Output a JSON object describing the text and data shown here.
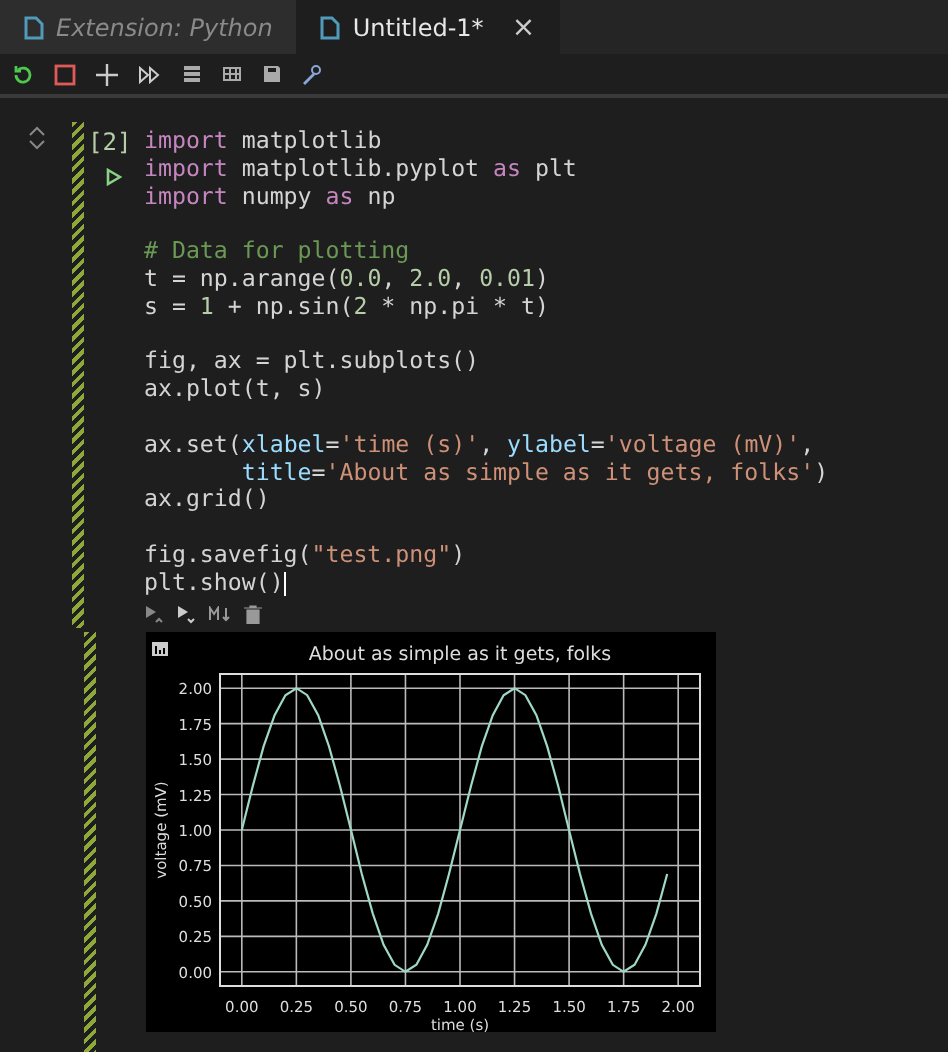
{
  "tabs": [
    {
      "label": "Extension: Python",
      "selected": false
    },
    {
      "label": "Untitled-1*",
      "selected": true,
      "close": "×"
    }
  ],
  "cell": {
    "execution_count": "[2]",
    "code_blocks": [
      [
        [
          {
            "text": "import",
            "kind": "keyword"
          },
          {
            "text": " matplotlib",
            "kind": "plain"
          }
        ],
        [
          {
            "text": "import",
            "kind": "keyword"
          },
          {
            "text": " matplotlib.pyplot ",
            "kind": "plain"
          },
          {
            "text": "as",
            "kind": "keyword"
          },
          {
            "text": " plt",
            "kind": "plain"
          }
        ],
        [
          {
            "text": "import",
            "kind": "keyword"
          },
          {
            "text": " numpy ",
            "kind": "plain"
          },
          {
            "text": "as",
            "kind": "keyword"
          },
          {
            "text": " np",
            "kind": "plain"
          }
        ]
      ],
      [
        [
          {
            "text": "# Data for plotting",
            "kind": "comment"
          }
        ],
        [
          {
            "text": "t = np.arange(",
            "kind": "plain"
          },
          {
            "text": "0.0",
            "kind": "number"
          },
          {
            "text": ", ",
            "kind": "plain"
          },
          {
            "text": "2.0",
            "kind": "number"
          },
          {
            "text": ", ",
            "kind": "plain"
          },
          {
            "text": "0.01",
            "kind": "number"
          },
          {
            "text": ")",
            "kind": "plain"
          }
        ],
        [
          {
            "text": "s = ",
            "kind": "plain"
          },
          {
            "text": "1",
            "kind": "number"
          },
          {
            "text": " + np.sin(",
            "kind": "plain"
          },
          {
            "text": "2",
            "kind": "number"
          },
          {
            "text": " * np.pi * t)",
            "kind": "plain"
          }
        ]
      ],
      [
        [
          {
            "text": "fig, ax = plt.subplots()",
            "kind": "plain"
          }
        ],
        [
          {
            "text": "ax.plot(t, s)",
            "kind": "plain"
          }
        ]
      ],
      [
        [
          {
            "text": "ax.set(",
            "kind": "plain"
          },
          {
            "text": "xlabel",
            "kind": "param"
          },
          {
            "text": "=",
            "kind": "plain"
          },
          {
            "text": "'time (s)'",
            "kind": "string"
          },
          {
            "text": ", ",
            "kind": "plain"
          },
          {
            "text": "ylabel",
            "kind": "param"
          },
          {
            "text": "=",
            "kind": "plain"
          },
          {
            "text": "'voltage (mV)'",
            "kind": "string"
          },
          {
            "text": ",",
            "kind": "plain"
          }
        ],
        [
          {
            "text": "       title",
            "kind": "param"
          },
          {
            "text": "=",
            "kind": "plain"
          },
          {
            "text": "'About as simple as it gets, folks'",
            "kind": "string"
          },
          {
            "text": ")",
            "kind": "plain"
          }
        ],
        [
          {
            "text": "ax.grid()",
            "kind": "plain"
          }
        ]
      ],
      [
        [
          {
            "text": "fig.savefig(",
            "kind": "plain"
          },
          {
            "text": "\"test.png\"",
            "kind": "string"
          },
          {
            "text": ")",
            "kind": "plain"
          }
        ],
        [
          {
            "text": "plt.show()",
            "kind": "plain"
          }
        ]
      ]
    ]
  },
  "output": {
    "chart_data": {
      "type": "line",
      "title": "About as simple as it gets, folks",
      "xlabel": "time (s)",
      "ylabel": "voltage (mV)",
      "x": [
        0,
        0.05,
        0.1,
        0.15,
        0.2,
        0.25,
        0.3,
        0.35,
        0.4,
        0.45,
        0.5,
        0.55,
        0.6,
        0.65,
        0.7,
        0.75,
        0.8,
        0.85,
        0.9,
        0.95,
        1,
        1.05,
        1.1,
        1.15,
        1.2,
        1.25,
        1.3,
        1.35,
        1.4,
        1.45,
        1.5,
        1.55,
        1.6,
        1.65,
        1.7,
        1.75,
        1.8,
        1.85,
        1.9,
        1.95
      ],
      "grid": true,
      "series": [
        {
          "color": "#9fd8c8",
          "values": [
            1,
            1.31,
            1.59,
            1.81,
            1.95,
            2,
            1.95,
            1.81,
            1.59,
            1.31,
            1,
            0.69,
            0.41,
            0.19,
            0.05,
            0,
            0.05,
            0.19,
            0.41,
            0.69,
            1,
            1.31,
            1.59,
            1.81,
            1.95,
            2,
            1.95,
            1.81,
            1.59,
            1.31,
            1,
            0.69,
            0.41,
            0.19,
            0.05,
            0,
            0.05,
            0.19,
            0.41,
            0.69
          ]
        }
      ],
      "xlim": [
        -0.1,
        2.1
      ],
      "ylim": [
        -0.1,
        2.1
      ],
      "xticks": [
        {
          "value": 0,
          "label": "0.00"
        },
        {
          "value": 0.25,
          "label": "0.25"
        },
        {
          "value": 0.5,
          "label": "0.50"
        },
        {
          "value": 0.75,
          "label": "0.75"
        },
        {
          "value": 1,
          "label": "1.00"
        },
        {
          "value": 1.25,
          "label": "1.25"
        },
        {
          "value": 1.5,
          "label": "1.50"
        },
        {
          "value": 1.75,
          "label": "1.75"
        },
        {
          "value": 2,
          "label": "2.00"
        }
      ],
      "yticks": [
        {
          "value": 0,
          "label": "0.00"
        },
        {
          "value": 0.25,
          "label": "0.25"
        },
        {
          "value": 0.5,
          "label": "0.50"
        },
        {
          "value": 0.75,
          "label": "0.75"
        },
        {
          "value": 1,
          "label": "1.00"
        },
        {
          "value": 1.25,
          "label": "1.25"
        },
        {
          "value": 1.5,
          "label": "1.50"
        },
        {
          "value": 1.75,
          "label": "1.75"
        },
        {
          "value": 2,
          "label": "2.00"
        }
      ]
    }
  }
}
